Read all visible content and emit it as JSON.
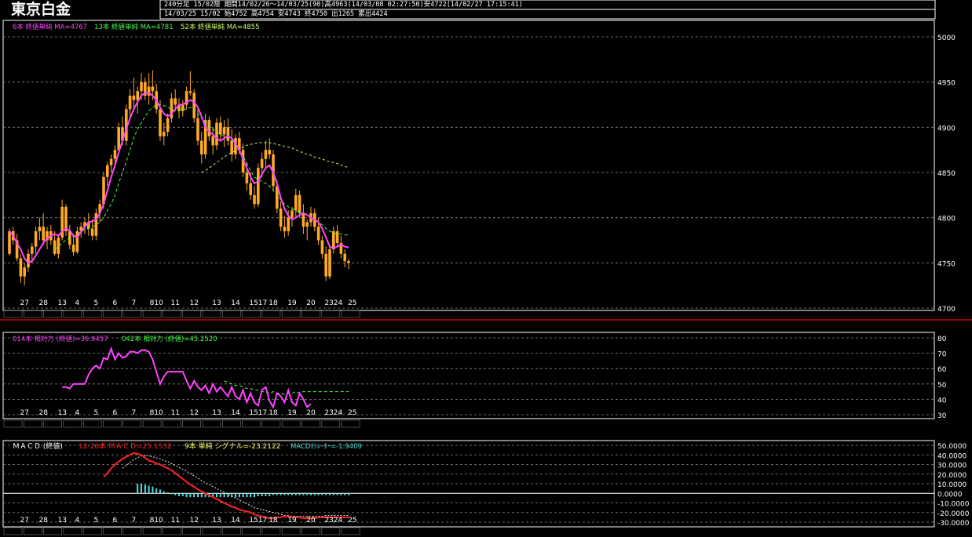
{
  "header": {
    "title": "東京白金",
    "line1": "240分足 15/02限 期間14/02/26～14/03/25(90)高4963(14/03/08 02:27:50)安4722(14/02/27 17:15:41)",
    "line2": "14/03/25 15/02 始4752 高4754 安4743 終4750 出1265 累出4424"
  },
  "legends": {
    "ma6": "6本 終値単純 MA=4767",
    "ma13": "13本 終値単純 MA=4781",
    "ma52": "52本 終値単純 MA=4855",
    "rsi14": "014本 相対力 (終値)=36.9457",
    "rsi42": "042本 相対力 (終値)=45.2520",
    "macd_title": "ＭＡＣＤ (終値)",
    "macd_line": "12-26本 ＭＡＣＤ=25.1532",
    "signal": "9本 単純 シグナル=-23.2122",
    "osc": "MACDｵｼﾚｰﾀｰ=-1.9409"
  },
  "colors": {
    "up": "#ffaa22",
    "down": "#ffaa22",
    "ma6": "#ff44ff",
    "ma13": "#44ff44",
    "ma52": "#ccff66",
    "rsi": "#ff44ff",
    "macd": "#ff2222",
    "signal": "#eeeeee",
    "osc": "#55dddd",
    "grid": "#888888",
    "separator": "#cc0000"
  },
  "chart_data": [
    {
      "type": "candlestick",
      "ylim": [
        4700,
        5000
      ],
      "yticks": [
        4700,
        4750,
        4800,
        4850,
        4900,
        4950,
        5000
      ],
      "grid": true,
      "date_labels": [
        "27",
        "28",
        "13",
        "4",
        "5",
        "6",
        "7",
        "810",
        "11",
        "12",
        "13",
        "14",
        "1517",
        "18",
        "19",
        "20",
        "2324",
        "25"
      ],
      "date_label_index": [
        4,
        9,
        14,
        18,
        23,
        28,
        33,
        39,
        44,
        49,
        55,
        60,
        66,
        70,
        75,
        80,
        86,
        91
      ],
      "ohlc": [
        [
          4760,
          4788,
          4758,
          4785
        ],
        [
          4785,
          4790,
          4770,
          4775
        ],
        [
          4775,
          4782,
          4752,
          4755
        ],
        [
          4755,
          4760,
          4728,
          4735
        ],
        [
          4735,
          4750,
          4725,
          4745
        ],
        [
          4745,
          4765,
          4740,
          4760
        ],
        [
          4760,
          4772,
          4750,
          4768
        ],
        [
          4768,
          4790,
          4760,
          4785
        ],
        [
          4785,
          4800,
          4775,
          4790
        ],
        [
          4790,
          4805,
          4770,
          4775
        ],
        [
          4775,
          4790,
          4765,
          4785
        ],
        [
          4785,
          4792,
          4770,
          4775
        ],
        [
          4775,
          4785,
          4758,
          4760
        ],
        [
          4760,
          4782,
          4755,
          4778
        ],
        [
          4778,
          4820,
          4775,
          4812
        ],
        [
          4812,
          4815,
          4780,
          4785
        ],
        [
          4785,
          4792,
          4765,
          4770
        ],
        [
          4770,
          4780,
          4758,
          4762
        ],
        [
          4762,
          4790,
          4760,
          4785
        ],
        [
          4785,
          4795,
          4778,
          4790
        ],
        [
          4790,
          4800,
          4782,
          4795
        ],
        [
          4795,
          4805,
          4780,
          4788
        ],
        [
          4788,
          4798,
          4775,
          4780
        ],
        [
          4780,
          4810,
          4775,
          4805
        ],
        [
          4805,
          4820,
          4795,
          4815
        ],
        [
          4815,
          4850,
          4810,
          4845
        ],
        [
          4845,
          4862,
          4835,
          4858
        ],
        [
          4858,
          4870,
          4850,
          4865
        ],
        [
          4865,
          4880,
          4855,
          4875
        ],
        [
          4875,
          4905,
          4870,
          4900
        ],
        [
          4900,
          4912,
          4880,
          4885
        ],
        [
          4885,
          4925,
          4880,
          4920
        ],
        [
          4920,
          4942,
          4910,
          4935
        ],
        [
          4935,
          4955,
          4920,
          4930
        ],
        [
          4930,
          4945,
          4915,
          4940
        ],
        [
          4940,
          4960,
          4930,
          4950
        ],
        [
          4950,
          4955,
          4930,
          4935
        ],
        [
          4935,
          4960,
          4925,
          4945
        ],
        [
          4945,
          4963,
          4930,
          4940
        ],
        [
          4940,
          4948,
          4915,
          4920
        ],
        [
          4920,
          4930,
          4885,
          4890
        ],
        [
          4890,
          4905,
          4880,
          4895
        ],
        [
          4895,
          4915,
          4890,
          4910
        ],
        [
          4910,
          4938,
          4905,
          4932
        ],
        [
          4932,
          4942,
          4920,
          4925
        ],
        [
          4925,
          4932,
          4910,
          4918
        ],
        [
          4918,
          4930,
          4912,
          4925
        ],
        [
          4925,
          4945,
          4920,
          4940
        ],
        [
          4940,
          4962,
          4935,
          4938
        ],
        [
          4938,
          4942,
          4905,
          4910
        ],
        [
          4910,
          4920,
          4880,
          4885
        ],
        [
          4885,
          4895,
          4860,
          4870
        ],
        [
          4870,
          4915,
          4865,
          4908
        ],
        [
          4908,
          4912,
          4885,
          4890
        ],
        [
          4890,
          4900,
          4870,
          4880
        ],
        [
          4880,
          4910,
          4875,
          4905
        ],
        [
          4905,
          4912,
          4885,
          4892
        ],
        [
          4892,
          4908,
          4878,
          4900
        ],
        [
          4900,
          4910,
          4880,
          4885
        ],
        [
          4885,
          4898,
          4862,
          4870
        ],
        [
          4870,
          4892,
          4865,
          4888
        ],
        [
          4888,
          4895,
          4870,
          4875
        ],
        [
          4875,
          4882,
          4845,
          4850
        ],
        [
          4850,
          4862,
          4830,
          4838
        ],
        [
          4838,
          4850,
          4820,
          4825
        ],
        [
          4825,
          4835,
          4810,
          4815
        ],
        [
          4815,
          4860,
          4812,
          4855
        ],
        [
          4855,
          4872,
          4845,
          4865
        ],
        [
          4865,
          4885,
          4855,
          4875
        ],
        [
          4875,
          4888,
          4865,
          4870
        ],
        [
          4870,
          4875,
          4830,
          4835
        ],
        [
          4835,
          4842,
          4805,
          4810
        ],
        [
          4810,
          4818,
          4785,
          4790
        ],
        [
          4790,
          4802,
          4778,
          4785
        ],
        [
          4785,
          4808,
          4780,
          4800
        ],
        [
          4800,
          4812,
          4790,
          4808
        ],
        [
          4808,
          4832,
          4800,
          4825
        ],
        [
          4825,
          4830,
          4800,
          4805
        ],
        [
          4805,
          4815,
          4782,
          4790
        ],
        [
          4790,
          4798,
          4775,
          4795
        ],
        [
          4795,
          4812,
          4790,
          4805
        ],
        [
          4805,
          4810,
          4785,
          4790
        ],
        [
          4790,
          4800,
          4770,
          4775
        ],
        [
          4775,
          4780,
          4755,
          4760
        ],
        [
          4760,
          4768,
          4730,
          4735
        ],
        [
          4735,
          4770,
          4732,
          4765
        ],
        [
          4765,
          4790,
          4760,
          4785
        ],
        [
          4785,
          4792,
          4768,
          4772
        ],
        [
          4772,
          4780,
          4755,
          4760
        ],
        [
          4760,
          4765,
          4745,
          4752
        ],
        [
          4752,
          4754,
          4743,
          4750
        ]
      ],
      "ma6": [
        4785,
        4780,
        4772,
        4765,
        4755,
        4750,
        4752,
        4758,
        4765,
        4772,
        4777,
        4780,
        4782,
        4780,
        4785,
        4788,
        4786,
        4780,
        4778,
        4784,
        4790,
        4795,
        4796,
        4798,
        4805,
        4815,
        4830,
        4845,
        4858,
        4872,
        4885,
        4898,
        4910,
        4920,
        4928,
        4935,
        4938,
        4938,
        4935,
        4930,
        4922,
        4915,
        4912,
        4915,
        4920,
        4925,
        4925,
        4928,
        4930,
        4928,
        4922,
        4912,
        4900,
        4895,
        4892,
        4888,
        4885,
        4888,
        4890,
        4888,
        4882,
        4875,
        4865,
        4855,
        4845,
        4838,
        4840,
        4848,
        4855,
        4858,
        4850,
        4838,
        4822,
        4810,
        4802,
        4798,
        4800,
        4803,
        4805,
        4803,
        4800,
        4798,
        4795,
        4788,
        4778,
        4768,
        4766,
        4768,
        4770,
        4768,
        4767
      ],
      "ma13": [
        null,
        null,
        null,
        null,
        null,
        null,
        null,
        null,
        null,
        null,
        null,
        null,
        4765,
        4768,
        4772,
        4775,
        4778,
        4780,
        4782,
        4785,
        4786,
        4788,
        4790,
        4792,
        4795,
        4800,
        4808,
        4815,
        4825,
        4838,
        4850,
        4862,
        4875,
        4888,
        4898,
        4905,
        4912,
        4918,
        4922,
        4925,
        4925,
        4924,
        4922,
        4920,
        4918,
        4918,
        4920,
        4920,
        4922,
        4920,
        4915,
        4910,
        4905,
        4900,
        4898,
        4895,
        4892,
        4890,
        4888,
        4885,
        4880,
        4875,
        4868,
        4860,
        4852,
        4845,
        4842,
        4840,
        4838,
        4835,
        4830,
        4825,
        4820,
        4815,
        4812,
        4810,
        4808,
        4806,
        4805,
        4803,
        4800,
        4798,
        4795,
        4792,
        4788,
        4785,
        4783,
        4782,
        4782,
        4781,
        4781
      ],
      "ma52": [
        null,
        null,
        null,
        null,
        null,
        null,
        null,
        null,
        null,
        null,
        null,
        null,
        null,
        null,
        null,
        null,
        null,
        null,
        null,
        null,
        null,
        null,
        null,
        null,
        null,
        null,
        null,
        null,
        null,
        null,
        null,
        null,
        null,
        null,
        null,
        null,
        null,
        null,
        null,
        null,
        null,
        null,
        null,
        null,
        null,
        null,
        null,
        null,
        null,
        null,
        null,
        4850,
        4852,
        4855,
        4858,
        4861,
        4864,
        4867,
        4870,
        4872,
        4874,
        4876,
        4878,
        4880,
        4881,
        4882,
        4883,
        4883,
        4883,
        4883,
        4882,
        4881,
        4880,
        4879,
        4878,
        4877,
        4875,
        4873,
        4872,
        4870,
        4869,
        4867,
        4866,
        4865,
        4863,
        4862,
        4861,
        4860,
        4858,
        4857,
        4855
      ]
    },
    {
      "type": "line",
      "ylim": [
        30,
        80
      ],
      "yticks": [
        30,
        40,
        50,
        60,
        70,
        80
      ],
      "rsi14_start": 14,
      "rsi14": [
        48,
        48,
        47,
        50,
        50,
        50,
        50,
        56,
        60,
        62,
        60,
        67,
        66,
        73,
        66,
        70,
        67,
        68,
        71,
        71,
        70,
        72,
        72,
        71,
        66,
        58,
        50,
        55,
        58,
        58,
        58,
        58,
        58,
        52,
        47,
        52,
        48,
        46,
        49,
        44,
        50,
        45,
        48,
        45,
        42,
        48,
        42,
        40,
        46,
        38,
        44,
        38,
        36,
        46,
        48,
        39,
        35,
        44,
        42,
        38,
        46,
        38,
        36,
        44,
        40,
        35,
        37
      ],
      "rsi42_start": 57,
      "rsi42": [
        52,
        51,
        50,
        49,
        49,
        48,
        47,
        47,
        46,
        46,
        45,
        45,
        44,
        45,
        44,
        44,
        43,
        44,
        44,
        45,
        44,
        45,
        45,
        45,
        45,
        45,
        45,
        45,
        45,
        45,
        45,
        45,
        45,
        45
      ]
    },
    {
      "type": "line",
      "ylim": [
        -30,
        50
      ],
      "yticks": [
        50,
        40,
        30,
        20,
        10,
        0,
        -10,
        -20,
        -30
      ],
      "ytick_labels": [
        "50.0000",
        "40.0000",
        "30.0000",
        "20.0000",
        "10.0000",
        "0.0000",
        "-10.0000",
        "-20.0000",
        "-30.0000"
      ],
      "macd_start": 25,
      "macd": [
        17,
        21,
        26,
        30,
        33,
        36,
        38,
        40,
        42,
        41,
        40,
        37,
        34,
        33,
        31,
        30,
        28,
        26,
        24,
        21,
        18,
        15,
        12,
        9,
        7,
        4,
        2,
        0,
        -2,
        -4,
        -6,
        -8,
        -10,
        -12,
        -14,
        -15,
        -17,
        -18,
        -19,
        -20,
        -22,
        -23,
        -24,
        -25,
        -26,
        -26,
        -25,
        -25,
        -24,
        -24,
        -25,
        -25,
        -25,
        -26,
        -26,
        -26,
        -26,
        -25,
        -25,
        -25,
        -25,
        -25,
        -25,
        -25,
        -25,
        -25
      ],
      "signal_start": 30,
      "signal": [
        26,
        29,
        32,
        35,
        37,
        39,
        39,
        39,
        38,
        37,
        36,
        34,
        33,
        31,
        29,
        27,
        25,
        23,
        21,
        18,
        16,
        13,
        11,
        9,
        7,
        5,
        3,
        1,
        -1,
        -3,
        -5,
        -7,
        -9,
        -11,
        -13,
        -15,
        -16,
        -17,
        -18,
        -19,
        -20,
        -21,
        -22,
        -23,
        -23,
        -24,
        -24,
        -24,
        -24,
        -24,
        -24,
        -24,
        -24,
        -24,
        -23,
        -23,
        -23,
        -23,
        -23,
        -23,
        -23
      ],
      "osc_start": 34,
      "osc": [
        10,
        10,
        9,
        8,
        7,
        5,
        4,
        2,
        1,
        -1,
        -2,
        -3,
        -3,
        -4,
        -4,
        -4,
        -4,
        -4,
        -4,
        -4,
        -4,
        -4,
        -4,
        -4,
        -4,
        -4,
        -4,
        -4,
        -4,
        -4,
        -4,
        -4,
        -3,
        -3,
        -3,
        -3,
        -2,
        -2,
        -2,
        -2,
        -2,
        -2,
        -2,
        -2,
        -2,
        -2,
        -2,
        -2,
        -2,
        -2,
        -2,
        -2,
        -2,
        -2,
        -2,
        -2,
        -2
      ]
    }
  ]
}
